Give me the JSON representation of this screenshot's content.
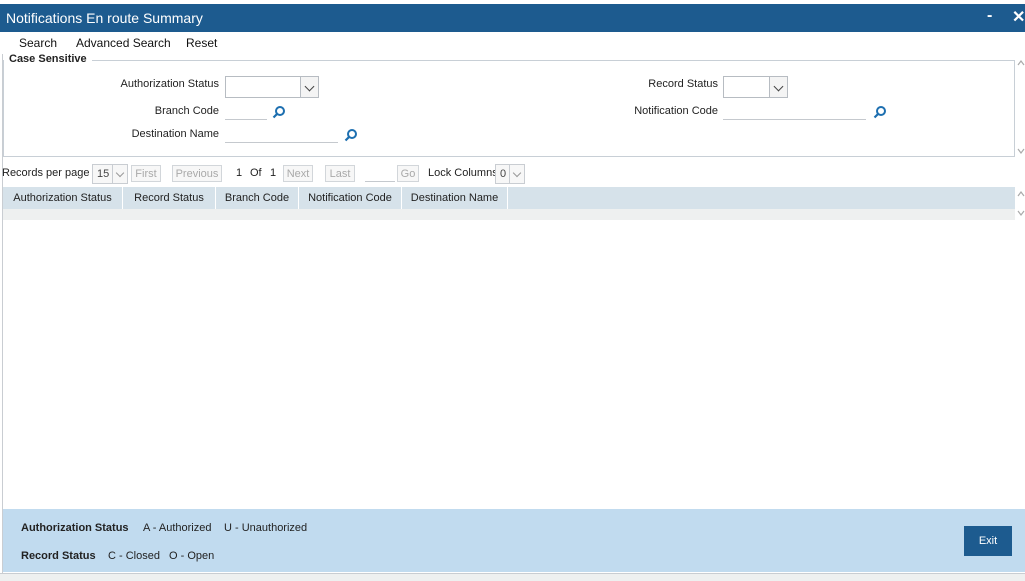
{
  "window": {
    "title": "Notifications En route Summary",
    "minimize": "-",
    "close": "✕"
  },
  "toolbar": {
    "search": "Search",
    "advanced_search": "Advanced Search",
    "reset": "Reset"
  },
  "criteria": {
    "legend": "Case Sensitive",
    "authorization_status": {
      "label": "Authorization Status",
      "value": ""
    },
    "record_status": {
      "label": "Record Status",
      "value": ""
    },
    "branch_code": {
      "label": "Branch Code",
      "value": ""
    },
    "notification_code": {
      "label": "Notification Code",
      "value": ""
    },
    "destination_name": {
      "label": "Destination Name",
      "value": ""
    }
  },
  "pager": {
    "records_per_page_label": "Records per page",
    "records_per_page": "15",
    "first": "First",
    "previous": "Previous",
    "current_page": "1",
    "of": "Of",
    "total_pages": "1",
    "next": "Next",
    "last": "Last",
    "go": "Go",
    "lock_columns_label": "Lock Columns",
    "lock_columns": "0"
  },
  "grid": {
    "columns": [
      "Authorization Status",
      "Record Status",
      "Branch Code",
      "Notification Code",
      "Destination Name"
    ]
  },
  "footer": {
    "auth_label": "Authorization Status",
    "auth_a": "A - Authorized",
    "auth_u": "U - Unauthorized",
    "record_label": "Record Status",
    "record_c": "C - Closed",
    "record_o": "O - Open",
    "exit": "Exit"
  },
  "colors": {
    "titlebar": "#1d5b8f",
    "footer": "#c1dbef",
    "grid_header": "#d6e2ea"
  },
  "icons": {
    "lookup": "magnifier-icon"
  }
}
